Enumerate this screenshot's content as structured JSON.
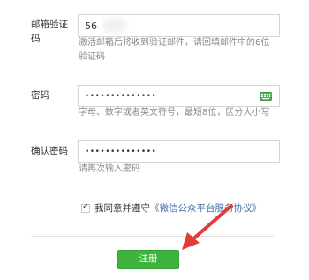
{
  "email_code": {
    "label_line1": "邮箱验证",
    "label_line2": "码",
    "value": "56",
    "hint_line1": "激活邮箱后将收到验证邮件，请回填邮件中的6位",
    "hint_line2": "验证码"
  },
  "password": {
    "label": "密码",
    "value": "••••••••••••••",
    "hint": "字母、数字或者英文符号，最短8位，区分大小写",
    "keyboard_icon": "keyboard-icon"
  },
  "confirm_password": {
    "label": "确认密码",
    "value": "••••••••••••••",
    "hint": "请再次输入密码"
  },
  "agreement": {
    "checked": true,
    "check_mark": "✓",
    "text": "我同意并遵守",
    "link": "《微信公众平台服务协议》"
  },
  "register_button": "注册",
  "colors": {
    "button_green": "#3eb33e",
    "keyboard_green": "#44b549",
    "arrow_red": "#e53a3a",
    "link_blue": "#3f6fa8"
  }
}
